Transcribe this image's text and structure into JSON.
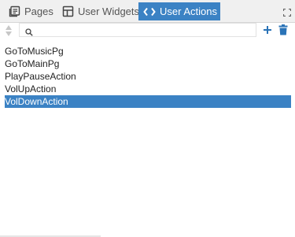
{
  "tabs": [
    {
      "label": "Pages",
      "icon": "pages-icon",
      "active": false
    },
    {
      "label": "User Widgets",
      "icon": "widgets-icon",
      "active": false
    },
    {
      "label": "User Actions",
      "icon": "code-icon",
      "active": true
    }
  ],
  "toolbar": {
    "search_value": "",
    "search_placeholder": ""
  },
  "actions": [
    {
      "label": "GoToMusicPg",
      "selected": false
    },
    {
      "label": "GoToMainPg",
      "selected": false
    },
    {
      "label": "PlayPauseAction",
      "selected": false
    },
    {
      "label": "VolUpAction",
      "selected": false
    },
    {
      "label": "VolDownAction",
      "selected": true
    }
  ],
  "colors": {
    "accent": "#3b82c4",
    "icon_blue": "#2a73b7"
  }
}
